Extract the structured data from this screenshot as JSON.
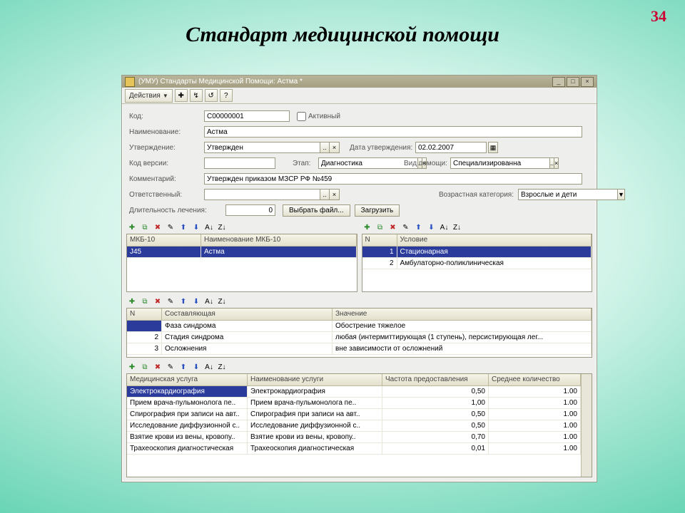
{
  "page": {
    "title": "Стандарт медицинской помощи",
    "number": "34"
  },
  "window": {
    "title": "(УМУ) Стандарты Медицинской Помощи: Астма *"
  },
  "toolbar": {
    "actions": "Действия",
    "help": "?"
  },
  "form": {
    "code_lbl": "Код:",
    "code": "С00000001",
    "active_lbl": "Активный",
    "name_lbl": "Наименование:",
    "name": "Астма",
    "approval_lbl": "Утверждение:",
    "approval": "Утвержден",
    "date_lbl": "Дата утверждения:",
    "date": "02.02.2007",
    "ver_lbl": "Код версии:",
    "stage_lbl": "Этап:",
    "stage": "Диагностика",
    "aid_lbl": "Вид помощи:",
    "aid": "Специализированна",
    "comment_lbl": "Комментарий:",
    "comment": "Утвержден приказом МЗСР РФ №459",
    "resp_lbl": "Ответственный:",
    "age_lbl": "Возрастная категория:",
    "age": "Взрослые и дети",
    "dur_lbl": "Длительность лечения:",
    "dur": "0",
    "file_btn": "Выбрать файл...",
    "load_btn": "Загрузить"
  },
  "grid1": {
    "h1": "МКБ-10",
    "h2": "Наименование МКБ-10",
    "rows": [
      {
        "c": "J45",
        "n": "Астма"
      }
    ]
  },
  "grid2": {
    "h1": "N",
    "h2": "Условие",
    "rows": [
      {
        "n": "1",
        "t": "Стационарная"
      },
      {
        "n": "2",
        "t": "Амбулаторно-поликлиническая"
      }
    ]
  },
  "grid3": {
    "h1": "N",
    "h2": "Составляющая",
    "h3": "Значение",
    "rows": [
      {
        "n": "",
        "c": "Фаза синдрома",
        "v": "Обострение тяжелое"
      },
      {
        "n": "2",
        "c": "Стадия синдрома",
        "v": "любая (интермиттирующая (1 ступень), персистирующая лег..."
      },
      {
        "n": "3",
        "c": "Осложнения",
        "v": "вне зависимости от осложнений"
      }
    ]
  },
  "grid4": {
    "h1": "Медицинская услуга",
    "h2": "Наименование услуги",
    "h3": "Частота предоставления",
    "h4": "Среднее количество",
    "rows": [
      {
        "a": "Электрокардиография",
        "b": "Электрокардиография",
        "c": "0,50",
        "d": "1.00"
      },
      {
        "a": "Прием врача-пульмонолога пе..",
        "b": "Прием врача-пульмонолога пе..",
        "c": "1,00",
        "d": "1.00"
      },
      {
        "a": "Спирография при записи на авт..",
        "b": "Спирография при записи на авт..",
        "c": "0,50",
        "d": "1.00"
      },
      {
        "a": "Исследование диффузионной с..",
        "b": "Исследование диффузионной с..",
        "c": "0,50",
        "d": "1.00"
      },
      {
        "a": "Взятие крови из вены, кровопу..",
        "b": "Взятие крови из вены, кровопу..",
        "c": "0,70",
        "d": "1.00"
      },
      {
        "a": "Трахеоскопия диагностическая",
        "b": "Трахеоскопия диагностическая",
        "c": "0,01",
        "d": "1.00"
      }
    ]
  }
}
